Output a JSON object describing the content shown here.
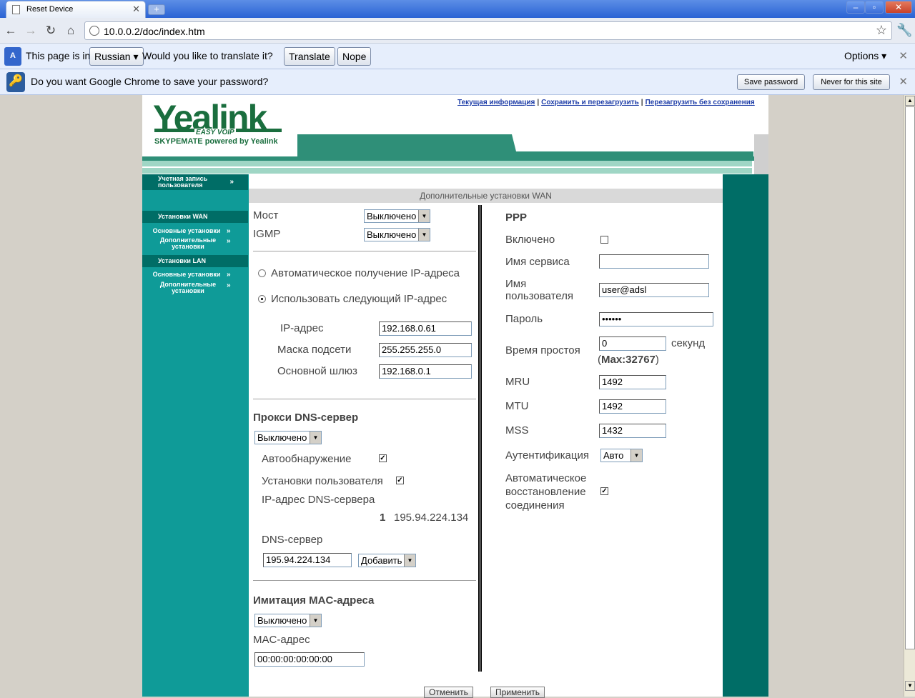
{
  "browser": {
    "tab_title": "Reset Device",
    "tab_close": "✕",
    "new_tab": "+",
    "url": "10.0.0.2/doc/index.htm",
    "window_controls": {
      "minimize": "–",
      "maximize": "▫",
      "close": "✕"
    }
  },
  "translate_bar": {
    "prefix": "This page is in",
    "language": "Russian",
    "question": "Would you like to translate it?",
    "translate_btn": "Translate",
    "nope_btn": "Nope",
    "options": "Options",
    "close": "✕"
  },
  "password_bar": {
    "question": "Do you want Google Chrome to save your password?",
    "save_btn": "Save password",
    "never_btn": "Never for this site",
    "close": "✕"
  },
  "header": {
    "logo": "Yealink",
    "logo_sub": "EASY VOIP",
    "logo_tagline": "SKYPEMATE powered by Yealink",
    "links": [
      "Текущая информация",
      "Сохранить и перезагрузить",
      "Перезагрузить без сохранения"
    ],
    "link_separator": "|"
  },
  "sidebar": {
    "account": "Учетная запись пользователя",
    "wan_head": "Установки WAN",
    "wan_basic": "Основные установки",
    "wan_adv": "Дополнительные установки",
    "lan_head": "Установки LAN",
    "lan_basic": "Основные установки",
    "lan_adv": "Дополнительные установки"
  },
  "main": {
    "title": "Дополнительные установки WAN",
    "bridge_label": "Мост",
    "bridge_value": "Выключено",
    "igmp_label": "IGMP",
    "igmp_value": "Выключено",
    "auto_ip": "Автоматическое получение IP-адреса",
    "static_ip": "Использовать следующий IP-адрес",
    "ip_label": "IP-адрес",
    "ip_value": "192.168.0.61",
    "mask_label": "Маска подсети",
    "mask_value": "255.255.255.0",
    "gw_label": "Основной шлюз",
    "gw_value": "192.168.0.1",
    "dns_proxy_head": "Прокси DNS-сервер",
    "dns_proxy_value": "Выключено",
    "autodetect": "Автообнаружение",
    "user_settings": "Установки пользователя",
    "dns_ip_label": "IP-адрес DNS-сервера",
    "dns_index": "1",
    "dns_entry": "195.94.224.134",
    "dns_server_label": "DNS-сервер",
    "dns_server_value": "195.94.224.134",
    "add_value": "Добавить",
    "mac_head": "Имитация MAC-адреса",
    "mac_mode": "Выключено",
    "mac_label": "MAC-адрес",
    "mac_value": "00:00:00:00:00:00",
    "ppp_head": "PPP",
    "enabled_label": "Включено",
    "service_label": "Имя сервиса",
    "service_value": "",
    "user_label_1": "Имя",
    "user_label_2": "пользователя",
    "user_value": "user@adsl",
    "pass_label": "Пароль",
    "pass_value": "••••••",
    "idle_label": "Время простоя",
    "idle_value": "0",
    "idle_unit": "секунд",
    "idle_max_open": "(",
    "idle_max": "Max:32767",
    "idle_max_close": ")",
    "mru_label": "MRU",
    "mru_value": "1492",
    "mtu_label": "MTU",
    "mtu_value": "1492",
    "mss_label": "MSS",
    "mss_value": "1432",
    "auth_label": "Аутентификация",
    "auth_value": "Авто",
    "reconnect_1": "Автоматическое",
    "reconnect_2": "восстановление",
    "reconnect_3": "соединения",
    "cancel_btn": "Отменить",
    "apply_btn": "Применить"
  }
}
